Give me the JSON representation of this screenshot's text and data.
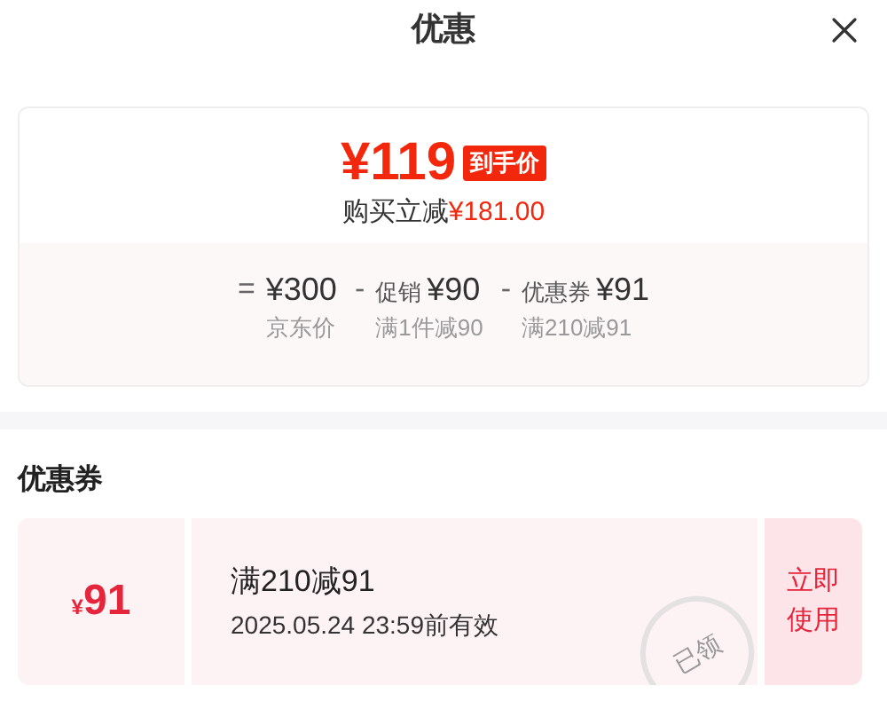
{
  "header": {
    "title": "优惠"
  },
  "price_card": {
    "final_price": "¥119",
    "badge": "到手价",
    "saving_label": "购买立减",
    "saving_amount": "¥181.00",
    "breakdown": [
      {
        "operator": "=",
        "amount": "¥300",
        "caption": "京东价"
      },
      {
        "operator": "-",
        "label": "促销",
        "amount": "¥90",
        "caption": "满1件减90"
      },
      {
        "operator": "-",
        "label": "优惠券",
        "amount": "¥91",
        "caption": "满210减91"
      }
    ]
  },
  "coupon_section": {
    "title": "优惠券",
    "coupons": [
      {
        "currency": "¥",
        "amount": "91",
        "title": "满210减91",
        "validity": "2025.05.24 23:59前有效",
        "stamp": "已领",
        "action": "立即使用"
      }
    ]
  }
}
